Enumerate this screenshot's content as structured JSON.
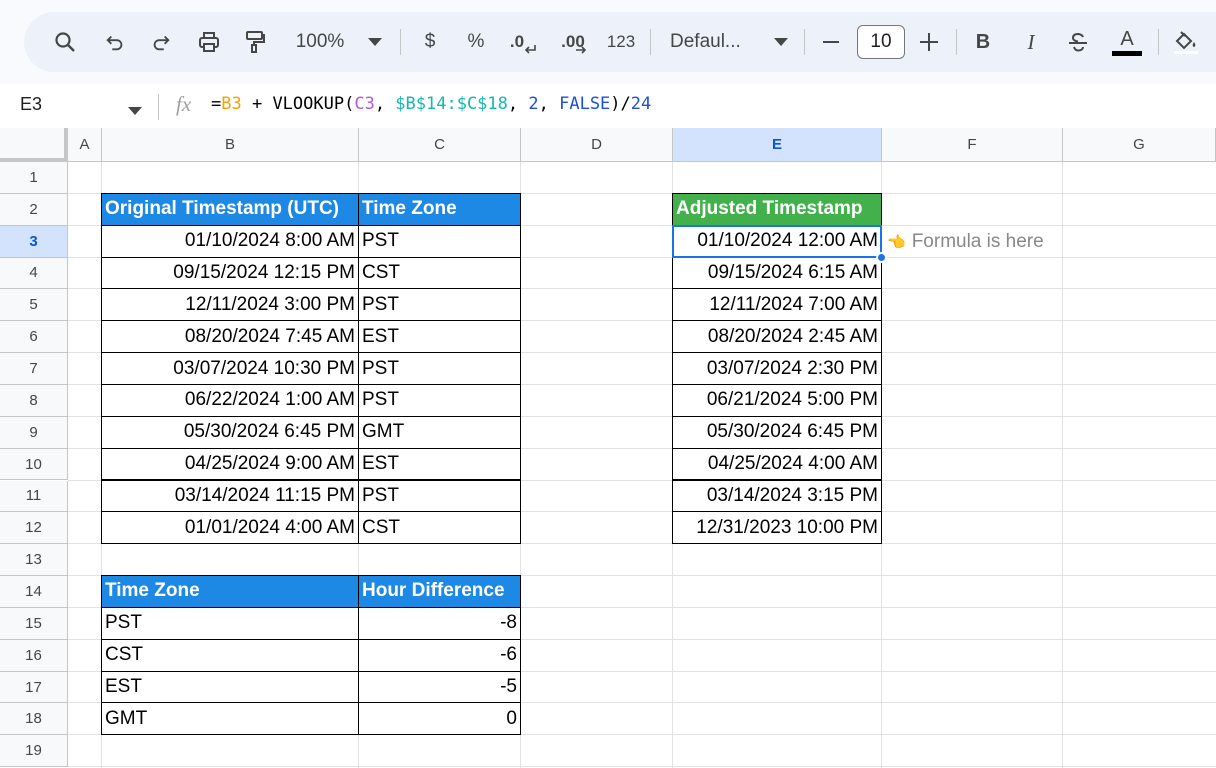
{
  "toolbar": {
    "zoom": "100%",
    "currency": "$",
    "percent": "%",
    "dec_decrease": ".0",
    "dec_increase": ".00",
    "number_format": "123",
    "font_name": "Defaul...",
    "font_size": "10",
    "bold": "B",
    "italic": "I",
    "text_color_label": "A"
  },
  "formula_bar": {
    "name_box": "E3",
    "fx": "fx",
    "formula_parts": [
      {
        "text": "=",
        "color": "#000000"
      },
      {
        "text": "B3",
        "color": "#f4a400"
      },
      {
        "text": " + VLOOKUP(",
        "color": "#000000"
      },
      {
        "text": "C3",
        "color": "#b15bd9"
      },
      {
        "text": ", ",
        "color": "#000000"
      },
      {
        "text": "$B$14:$C$18",
        "color": "#14b8b0"
      },
      {
        "text": ", ",
        "color": "#000000"
      },
      {
        "text": "2",
        "color": "#1e4fd8"
      },
      {
        "text": ", ",
        "color": "#000000"
      },
      {
        "text": "FALSE",
        "color": "#1e4fd8"
      },
      {
        "text": ")/",
        "color": "#000000"
      },
      {
        "text": "24",
        "color": "#1e4fd8"
      }
    ]
  },
  "columns": [
    "A",
    "B",
    "C",
    "D",
    "E",
    "F",
    "G"
  ],
  "rows": [
    "1",
    "2",
    "3",
    "4",
    "5",
    "6",
    "7",
    "8",
    "9",
    "10",
    "11",
    "12",
    "13",
    "14",
    "15",
    "16",
    "17",
    "18",
    "19"
  ],
  "selected_cell": {
    "col": "E",
    "row": "3"
  },
  "table1": {
    "headers": [
      "Original Timestamp (UTC)",
      "Time Zone"
    ],
    "rows": [
      [
        "01/10/2024 8:00 AM",
        "PST"
      ],
      [
        "09/15/2024 12:15 PM",
        "CST"
      ],
      [
        "12/11/2024 3:00 PM",
        "PST"
      ],
      [
        "08/20/2024 7:45 AM",
        "EST"
      ],
      [
        "03/07/2024 10:30 PM",
        "PST"
      ],
      [
        "06/22/2024 1:00 AM",
        "PST"
      ],
      [
        "05/30/2024 6:45 PM",
        "GMT"
      ],
      [
        "04/25/2024 9:00 AM",
        "EST"
      ],
      [
        "03/14/2024 11:15 PM",
        "PST"
      ],
      [
        "01/01/2024 4:00 AM",
        "CST"
      ]
    ]
  },
  "adjusted": {
    "header": "Adjusted Timestamp",
    "values": [
      "01/10/2024 12:00 AM",
      "09/15/2024 6:15 AM",
      "12/11/2024 7:00 AM",
      "08/20/2024 2:45 AM",
      "03/07/2024 2:30 PM",
      "06/21/2024 5:00 PM",
      "05/30/2024 6:45 PM",
      "04/25/2024 4:00 AM",
      "03/14/2024 3:15 PM",
      "12/31/2023 10:00 PM"
    ]
  },
  "note": {
    "pointer": "👈",
    "text": "Formula is here"
  },
  "table2": {
    "headers": [
      "Time Zone",
      "Hour Difference"
    ],
    "rows": [
      [
        "PST",
        "-8"
      ],
      [
        "CST",
        "-6"
      ],
      [
        "EST",
        "-5"
      ],
      [
        "GMT",
        "0"
      ]
    ]
  },
  "colors": {
    "header_blue": "#1e88e5",
    "header_green": "#43b14b",
    "selection_blue": "#1a73e8"
  }
}
